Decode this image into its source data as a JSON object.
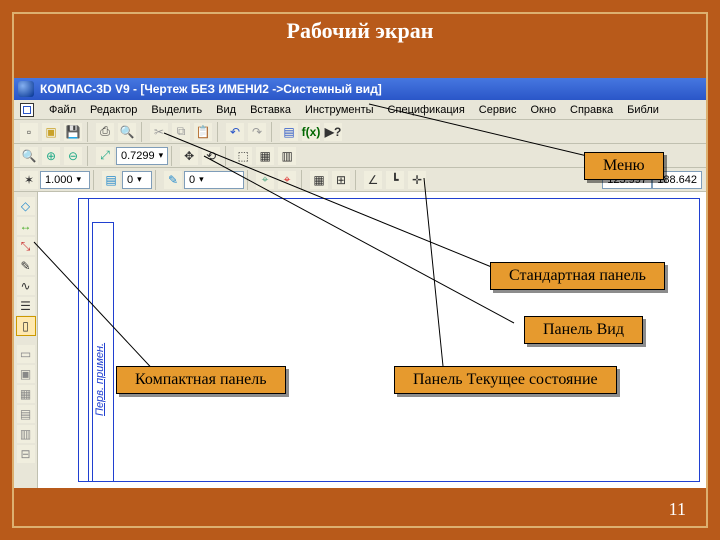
{
  "slide": {
    "title": "Рабочий экран",
    "page_number": "11"
  },
  "window": {
    "title": "КОМПАС-3D V9 - [Чертеж БЕЗ ИМЕНИ2 ->Системный вид]"
  },
  "menu": {
    "file": "Файл",
    "edit": "Редактор",
    "select": "Выделить",
    "view": "Вид",
    "insert": "Вставка",
    "tools": "Инструменты",
    "spec": "Спецификация",
    "service": "Сервис",
    "window": "Окно",
    "help": "Справка",
    "library": "Библи"
  },
  "toolbar1": {
    "fx": "f(x)"
  },
  "toolbar2": {
    "zoom_value": "0.7299"
  },
  "toolbar3": {
    "scale": "1.000",
    "step": "0",
    "layer": "0",
    "coord_x": "125.997",
    "coord_y": "188.642"
  },
  "canvas": {
    "vertical_label": "Перв. примен."
  },
  "callouts": {
    "menu": "Меню",
    "standard_panel": "Стандартная панель",
    "view_panel": "Панель Вид",
    "compact_panel": "Компактная панель",
    "state_panel": "Панель Текущее состояние"
  }
}
